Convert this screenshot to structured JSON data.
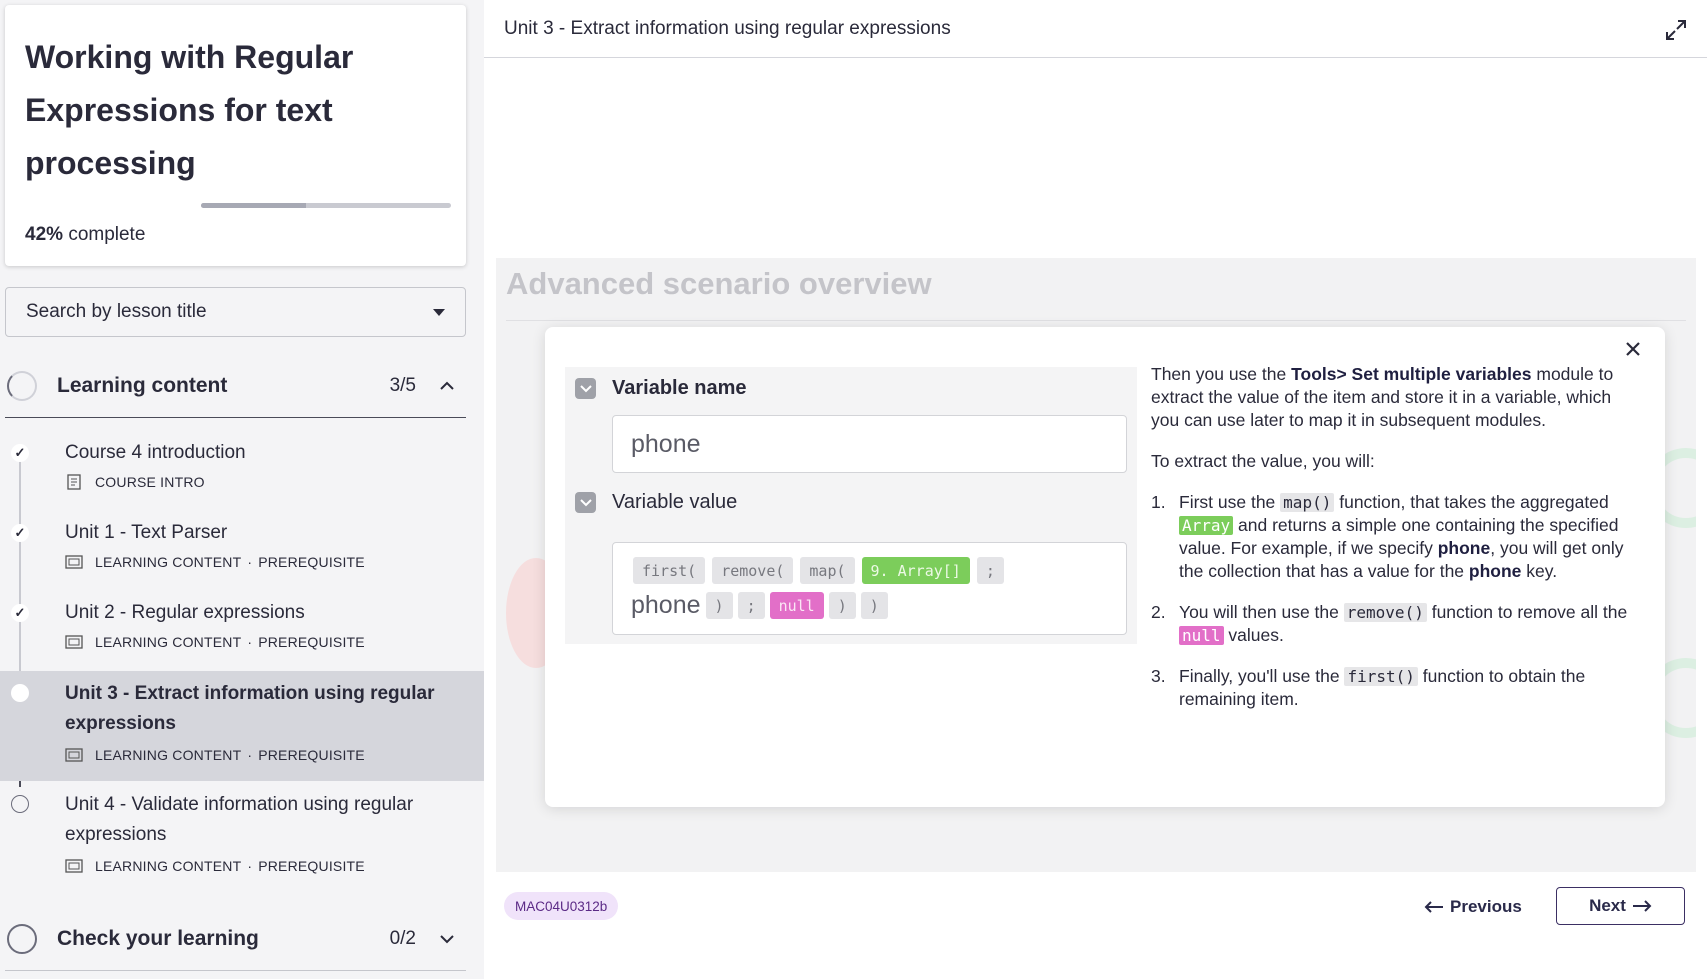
{
  "course": {
    "title": "Working with Regular Expressions for text processing",
    "progress_percent_label": "42%",
    "progress_suffix": "complete",
    "progress_value": 0.42
  },
  "search": {
    "placeholder": "Search by lesson title"
  },
  "sections": [
    {
      "label": "Learning content",
      "count": "3/5",
      "expanded": true
    },
    {
      "label": "Check your learning",
      "count": "0/2",
      "expanded": false
    }
  ],
  "lessons": [
    {
      "title": "Course 4 introduction",
      "type": "COURSE INTRO",
      "prereq": "",
      "status": "done",
      "icon": "document-icon"
    },
    {
      "title": "Unit 1 - Text Parser",
      "type": "LEARNING CONTENT",
      "prereq": "PREREQUISITE",
      "status": "done",
      "icon": "slides-icon"
    },
    {
      "title": "Unit 2 - Regular expressions",
      "type": "LEARNING CONTENT",
      "prereq": "PREREQUISITE",
      "status": "done",
      "icon": "slides-icon"
    },
    {
      "title": "Unit 3 - Extract information using regular expressions",
      "type": "LEARNING CONTENT",
      "prereq": "PREREQUISITE",
      "status": "current",
      "icon": "slides-icon"
    },
    {
      "title": "Unit 4 - Validate information using regular expressions",
      "type": "LEARNING CONTENT",
      "prereq": "PREREQUISITE",
      "status": "not-started",
      "icon": "slides-icon"
    }
  ],
  "meta_separator": "·",
  "check_mark": "✓",
  "main": {
    "header_title": "Unit 3 - Extract information using regular expressions",
    "background_title": "Advanced scenario overview",
    "popup": {
      "variable_name_label": "Variable name",
      "variable_name_value": "phone",
      "variable_value_label": "Variable value",
      "tokens_line1": [
        "first(",
        "remove(",
        "map(",
        "9. Array[]",
        ";"
      ],
      "token_word": "phone",
      "tokens_line2": [
        ")",
        ";",
        "null",
        ")",
        ")"
      ],
      "intro_before": "Then you use the",
      "intro_bold": "Tools> Set multiple variables",
      "intro_after": "module to extract the value of the item and store it in a variable, which you can use later to map it in subsequent modules.",
      "lead": "To extract the value, you will:",
      "step1_num": "1.",
      "step1_a": "First use the",
      "step1_code1": "map()",
      "step1_b": "function, that takes the aggregated",
      "step1_code2": "Array",
      "step1_c": "and returns a simple one containing the specified value. For example, if we specify",
      "step1_bold1": "phone",
      "step1_d": ", you will get only the collection that has a value for the",
      "step1_bold2": "phone",
      "step1_e": "key.",
      "step2_num": "2.",
      "step2_a": "You will then use the",
      "step2_code": "remove()",
      "step2_b": "function to remove all the",
      "step2_code2": "null",
      "step2_c": "values.",
      "step3_num": "3.",
      "step3_a": "Finally, you'll use the",
      "step3_code": "first()",
      "step3_b": "function to obtain the remaining item."
    },
    "lesson_code": "MAC04U0312b",
    "previous_label": "Previous",
    "next_label": "Next"
  },
  "colors": {
    "accent_navy": "#3b2f63",
    "green_token": "#7ccd5b",
    "pink_token": "#e26fc8",
    "badge_bg": "#f0e3fa"
  }
}
